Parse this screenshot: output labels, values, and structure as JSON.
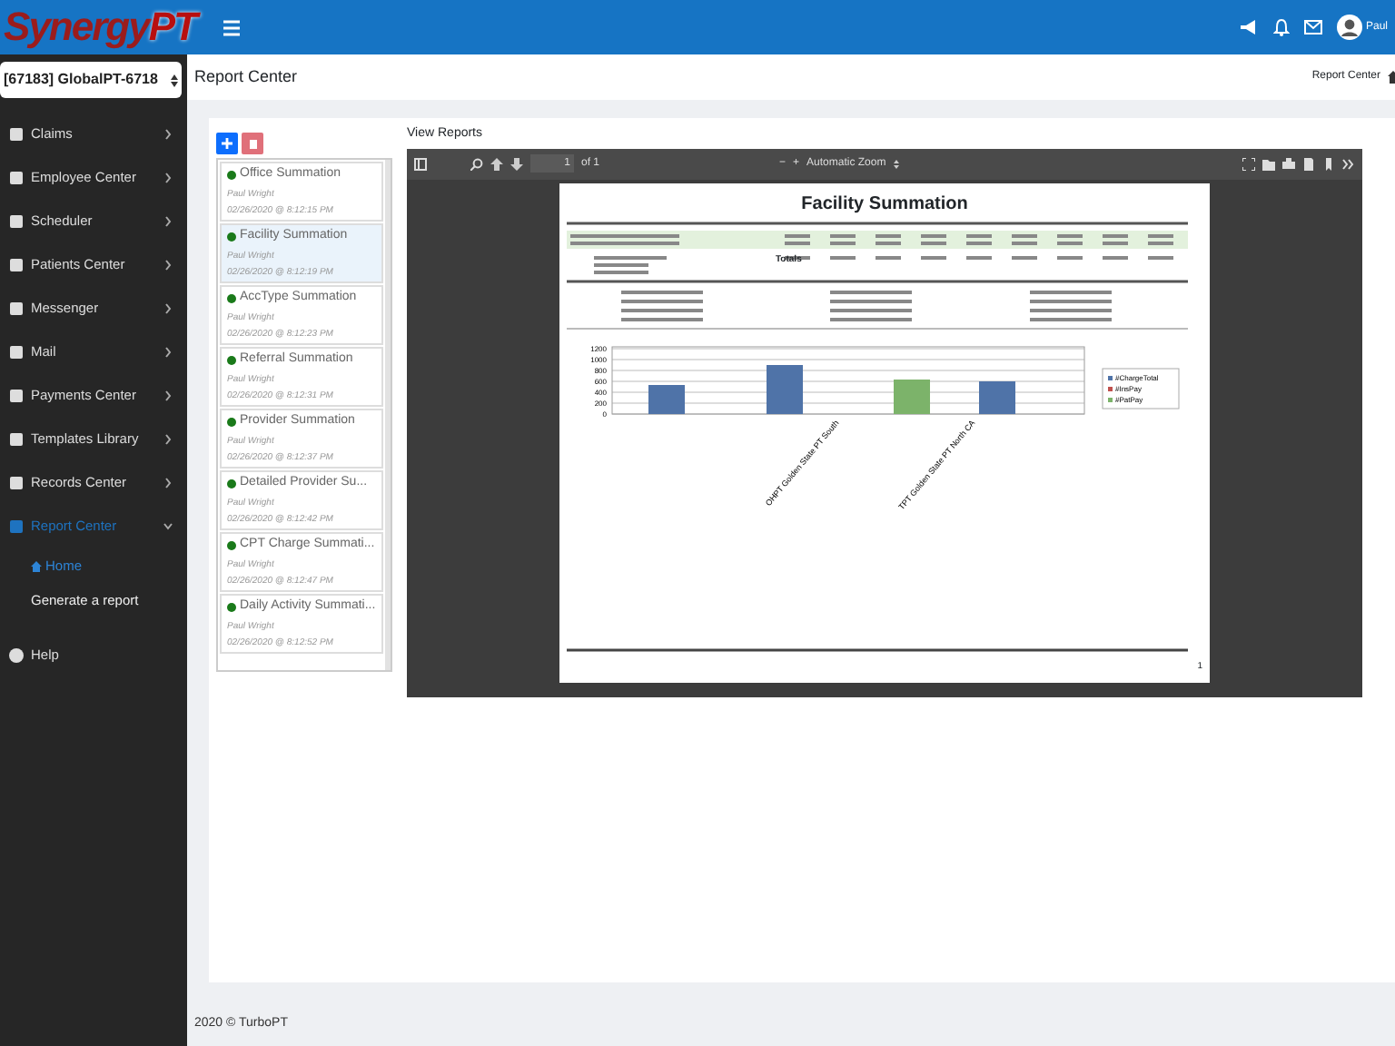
{
  "navbar": {
    "logo": [
      "S",
      "ynergy",
      "PT"
    ],
    "user": "Paul"
  },
  "sidebar": {
    "facility_select": "[67183] GlobalPT-6718",
    "items": [
      {
        "label": "Claims",
        "kind": "menu",
        "expanded": false,
        "selected": false
      },
      {
        "label": "Employee Center",
        "kind": "menu",
        "expanded": false,
        "selected": false
      },
      {
        "label": "Scheduler",
        "kind": "menu",
        "expanded": false,
        "selected": false
      },
      {
        "label": "Patients Center",
        "kind": "menu",
        "expanded": false,
        "selected": false
      },
      {
        "label": "Messenger",
        "kind": "menu",
        "expanded": false,
        "selected": false
      },
      {
        "label": "Mail",
        "kind": "menu",
        "expanded": false,
        "selected": false
      },
      {
        "label": "Payments Center",
        "kind": "menu",
        "expanded": false,
        "selected": false
      },
      {
        "label": "Templates Library",
        "kind": "menu",
        "expanded": false,
        "selected": false
      },
      {
        "label": "Records Center",
        "kind": "menu",
        "expanded": false,
        "selected": false
      },
      {
        "label": "Report Center",
        "kind": "menu",
        "expanded": true,
        "selected": true,
        "children": [
          {
            "label": "Home",
            "selected": true
          },
          {
            "label": "Generate a report",
            "selected": false
          }
        ]
      },
      {
        "label": "Help",
        "kind": "link",
        "expanded": false,
        "selected": false
      }
    ]
  },
  "header": {
    "title": "Report Center",
    "breadcrumb": "Report Center"
  },
  "reports": [
    {
      "name": "Office Summation",
      "author": "Paul Wright",
      "time": "02/26/2020 @ 8:12:15 PM",
      "selected": false
    },
    {
      "name": "Facility Summation",
      "author": "Paul Wright",
      "time": "02/26/2020 @ 8:12:19 PM",
      "selected": true
    },
    {
      "name": "AccType Summation",
      "author": "Paul Wright",
      "time": "02/26/2020 @ 8:12:23 PM",
      "selected": false
    },
    {
      "name": "Referral Summation",
      "author": "Paul Wright",
      "time": "02/26/2020 @ 8:12:31 PM",
      "selected": false
    },
    {
      "name": "Provider Summation",
      "author": "Paul Wright",
      "time": "02/26/2020 @ 8:12:37 PM",
      "selected": false
    },
    {
      "name": "Detailed Provider Su...",
      "author": "Paul Wright",
      "time": "02/26/2020 @ 8:12:42 PM",
      "selected": false
    },
    {
      "name": "CPT Charge Summati...",
      "author": "Paul Wright",
      "time": "02/26/2020 @ 8:12:47 PM",
      "selected": false
    },
    {
      "name": "Daily Activity Summati...",
      "author": "Paul Wright",
      "time": "02/26/2020 @ 8:12:52 PM",
      "selected": false
    }
  ],
  "viewer": {
    "label": "View Reports",
    "page": "1",
    "page_count": "of 1",
    "zoom_out": "−",
    "zoom_in": "+",
    "zoom": "Automatic Zoom",
    "document": {
      "title": "Facility Summation",
      "totals_label": "Totals",
      "chart": {
        "yticks": [
          "1200",
          "1000",
          "800",
          "600",
          "400",
          "200",
          "0"
        ],
        "xlabels": [
          "OHPT Golden State PT South",
          "TPT Golden State PT North CA"
        ],
        "legend": [
          "#ChargeTotal",
          "#InsPay",
          "#PatPay"
        ]
      },
      "page_number": "1"
    }
  },
  "footer": "2020 © TurboPT"
}
